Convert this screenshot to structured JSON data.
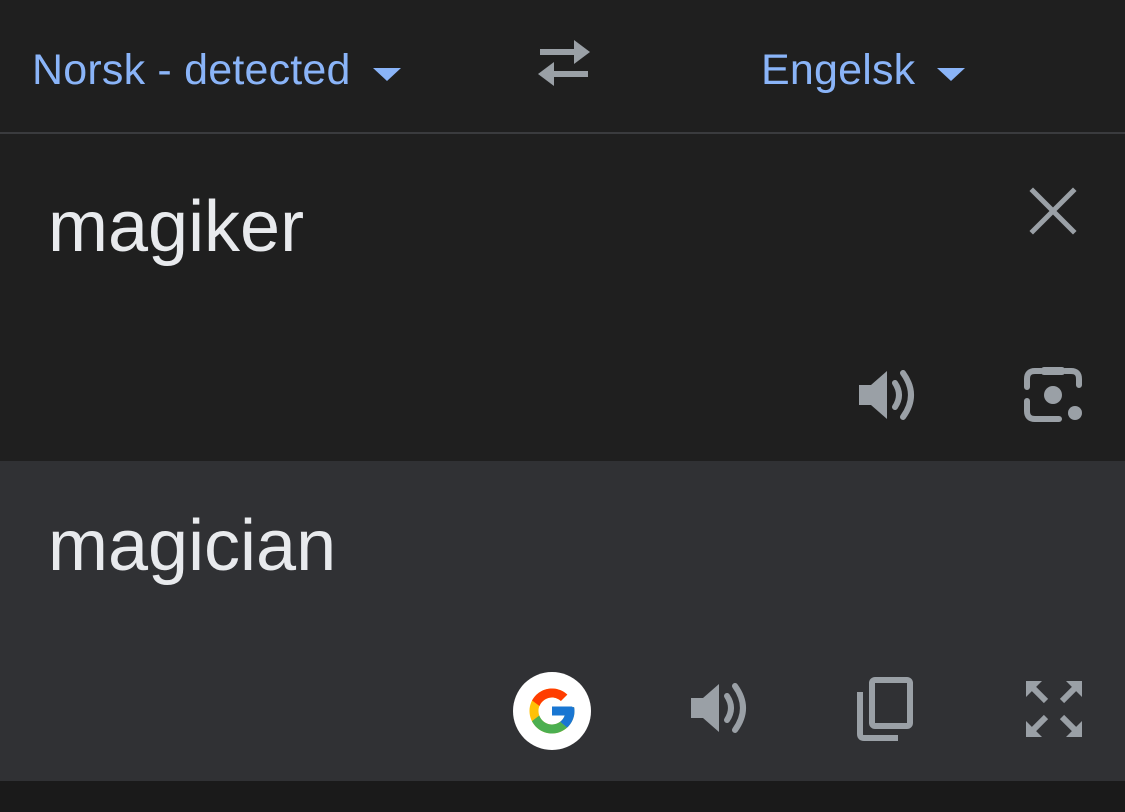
{
  "language_bar": {
    "source_language": "Norsk - detected",
    "target_language": "Engelsk",
    "swap_icon": "swap-arrows-icon"
  },
  "source": {
    "text": "magiker",
    "clear_icon": "close-icon",
    "speak_icon": "speaker-icon",
    "camera_icon": "camera-lens-icon"
  },
  "result": {
    "text": "magician",
    "google_icon": "google-logo-icon",
    "speak_icon": "speaker-icon",
    "copy_icon": "copy-icon",
    "fullscreen_icon": "fullscreen-icon"
  },
  "colors": {
    "background": "#1f1f1f",
    "result_background": "#303134",
    "accent": "#8ab4f8",
    "text": "#e8eaed",
    "icon": "#9aa0a6"
  }
}
